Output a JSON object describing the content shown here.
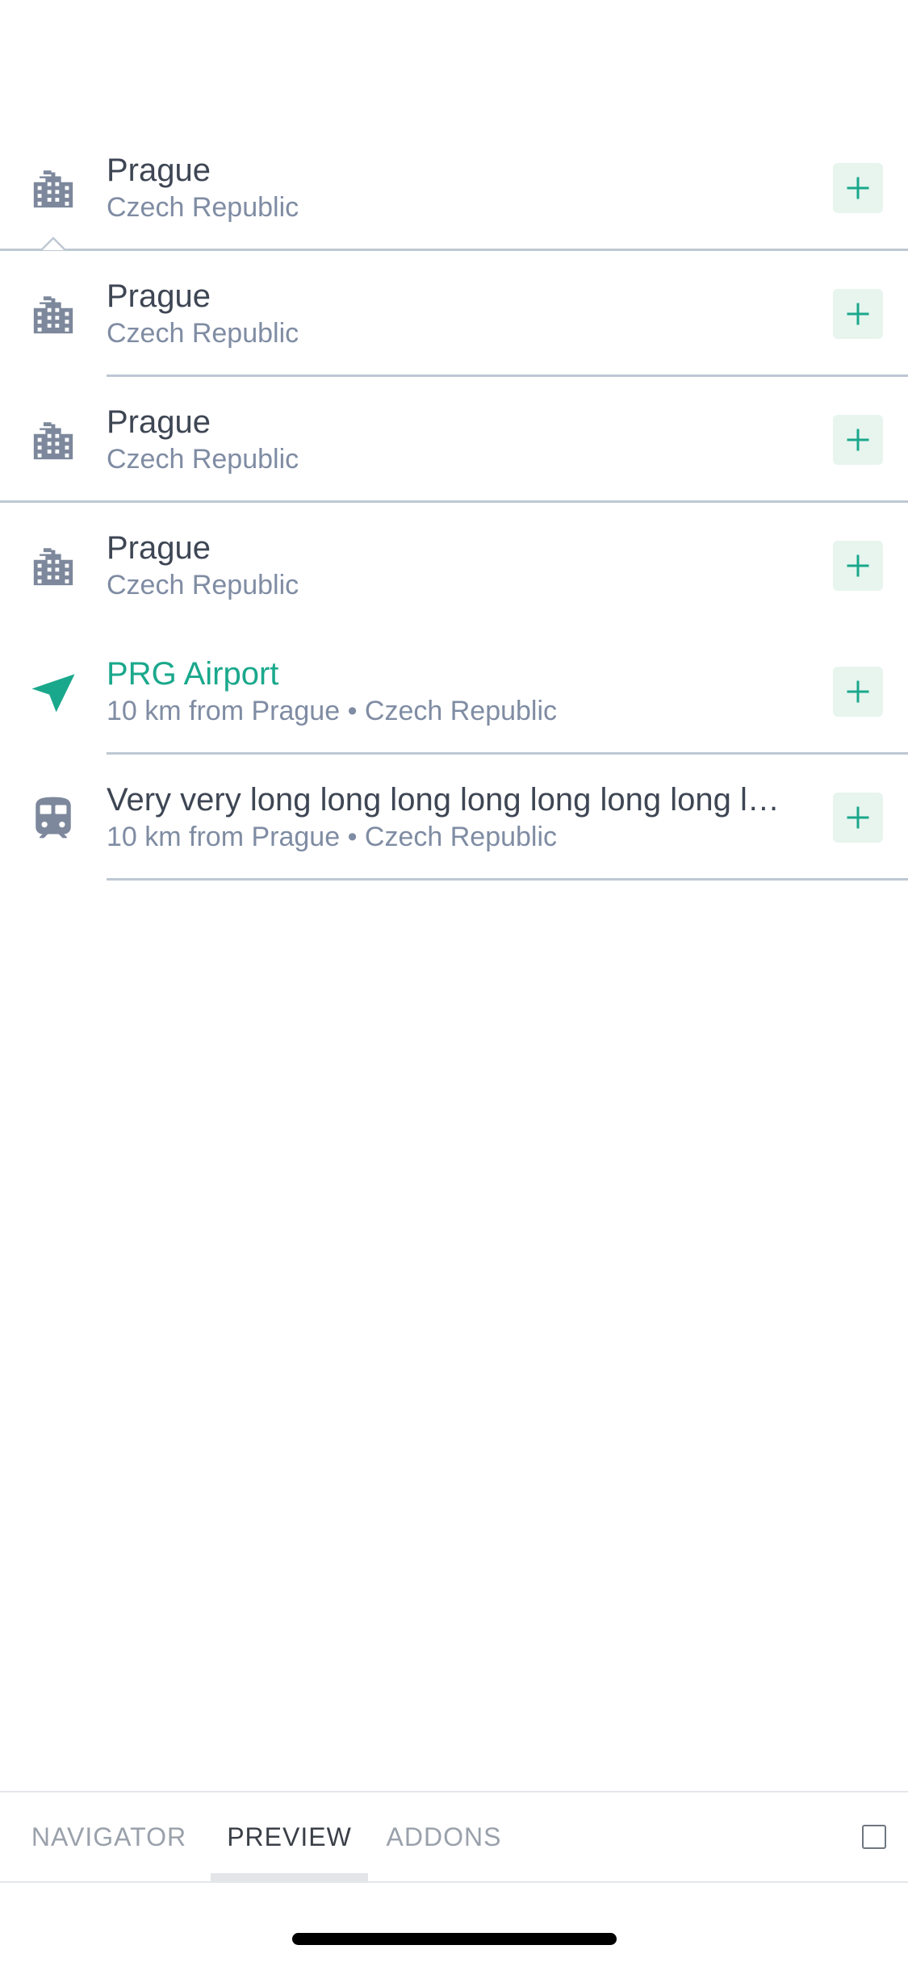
{
  "rows": [
    {
      "icon": "building-icon",
      "title": "Prague",
      "subtitle": "Czech Republic",
      "accent": false,
      "divider": "full",
      "caret": true
    },
    {
      "icon": "building-icon",
      "title": "Prague",
      "subtitle": "Czech Republic",
      "accent": false,
      "divider": "inset",
      "caret": false
    },
    {
      "icon": "building-icon",
      "title": "Prague",
      "subtitle": "Czech Republic",
      "accent": false,
      "divider": "full",
      "caret": false
    },
    {
      "icon": "building-icon",
      "title": "Prague",
      "subtitle": "Czech Republic",
      "accent": false,
      "divider": "none",
      "caret": false
    },
    {
      "icon": "navigation-arrow-icon",
      "title": "PRG Airport",
      "subtitle": "10 km from Prague • Czech Republic",
      "accent": true,
      "divider": "inset",
      "caret": false
    },
    {
      "icon": "train-icon",
      "title": "Very very long long long long long long long long long long long long",
      "subtitle": "10 km from Prague • Czech Republic",
      "accent": false,
      "divider": "inset",
      "caret": false
    }
  ],
  "add_button_icon": "plus-icon",
  "toolbar": {
    "tabs": [
      {
        "label": "NAVIGATOR",
        "active": false
      },
      {
        "label": "PREVIEW",
        "active": true
      },
      {
        "label": "ADDONS",
        "active": false
      }
    ],
    "right_icon": "square-icon"
  },
  "colors": {
    "title": "#3e4654",
    "subtitle": "#7f8ca3",
    "accent": "#1aa88c",
    "icon": "#7d889c",
    "add_button_bg": "#e7f5ee",
    "divider": "#bec8d3"
  }
}
